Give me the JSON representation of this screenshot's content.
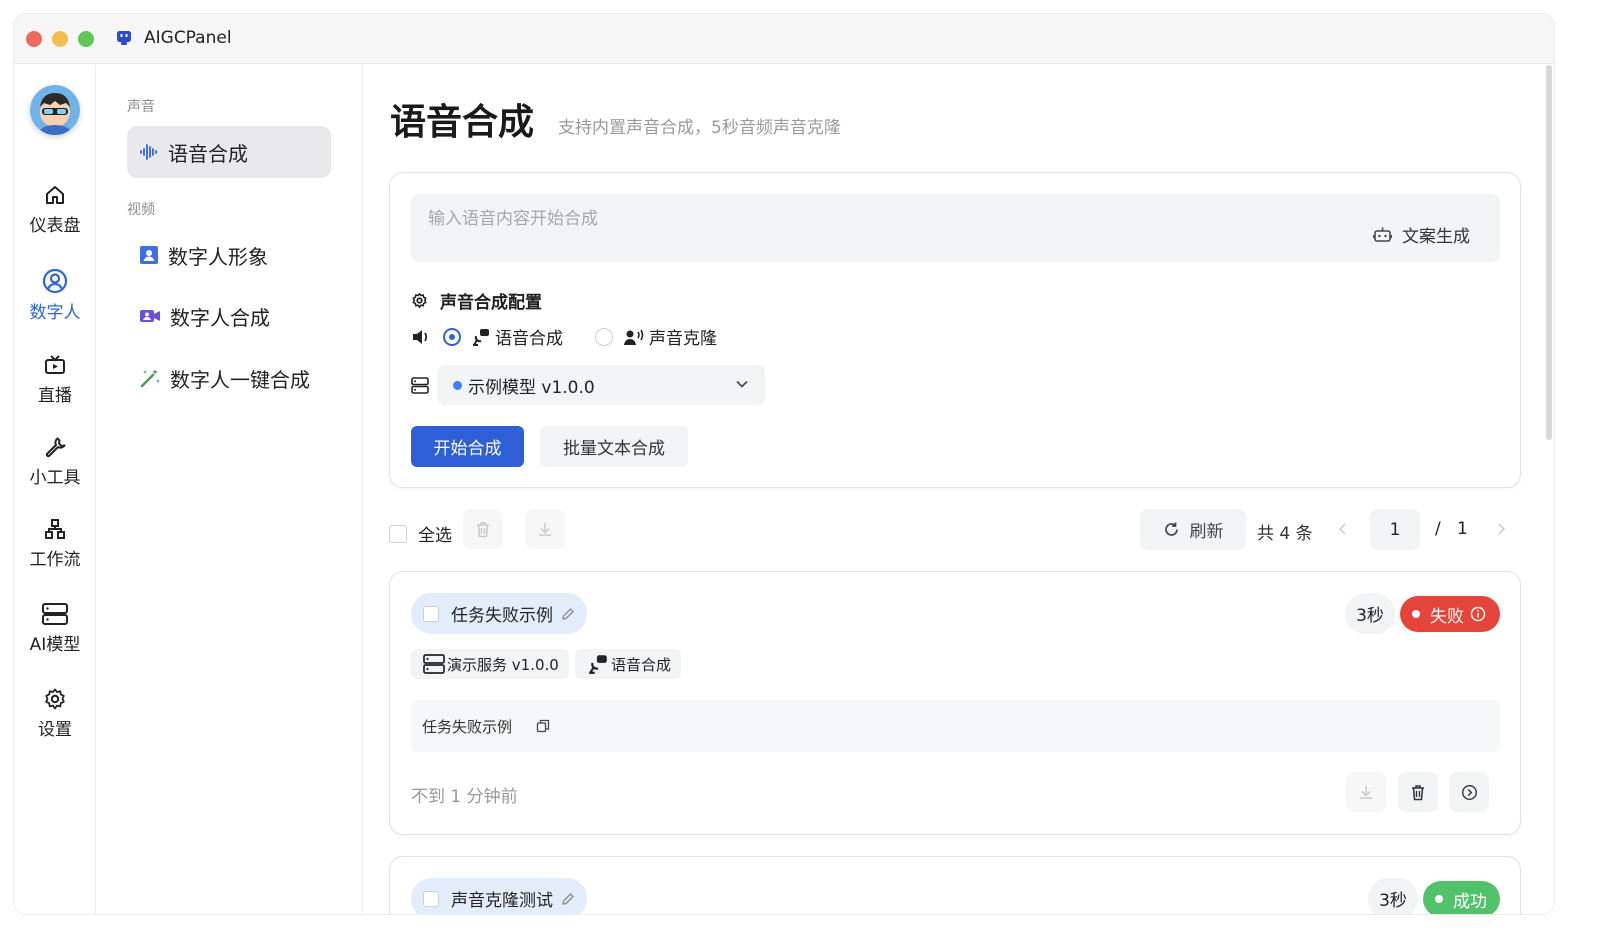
{
  "window": {
    "title": "AIGCPanel"
  },
  "rail": {
    "items": [
      {
        "label": "仪表盘",
        "icon": "home-icon"
      },
      {
        "label": "数字人",
        "icon": "user-circle-icon",
        "active": true
      },
      {
        "label": "直播",
        "icon": "tv-icon"
      },
      {
        "label": "小工具",
        "icon": "wrench-icon"
      },
      {
        "label": "工作流",
        "icon": "workflow-icon"
      },
      {
        "label": "AI模型",
        "icon": "server-icon"
      },
      {
        "label": "设置",
        "icon": "gear-icon"
      }
    ]
  },
  "subnav": {
    "group_sound": "声音",
    "group_video": "视频",
    "items": [
      {
        "label": "语音合成",
        "icon": "waveform-icon",
        "active": true
      },
      {
        "label": "数字人形象",
        "icon": "portrait-icon"
      },
      {
        "label": "数字人合成",
        "icon": "video-camera-icon"
      },
      {
        "label": "数字人一键合成",
        "icon": "magic-wand-icon"
      }
    ]
  },
  "header": {
    "title": "语音合成",
    "subtitle": "支持内置声音合成，5秒音频声音克隆"
  },
  "synth": {
    "placeholder": "输入语音内容开始合成",
    "gen_label": "文案生成",
    "config_title": "声音合成配置",
    "mode_options": [
      {
        "label": "语音合成",
        "selected": true
      },
      {
        "label": "声音克隆",
        "selected": false
      }
    ],
    "model_selected": "示例模型 v1.0.0",
    "start_label": "开始合成",
    "batch_label": "批量文本合成"
  },
  "toolbar": {
    "select_all": "全选",
    "refresh": "刷新",
    "total": "共 4 条",
    "page_current": "1",
    "page_sep": "/",
    "page_total": "1"
  },
  "tasks": [
    {
      "title": "任务失败示例",
      "duration": "3秒",
      "status": "失败",
      "tag_service": "演示服务 v1.0.0",
      "tag_type": "语音合成",
      "content": "任务失败示例",
      "time": "不到 1 分钟前"
    },
    {
      "title": "声音克隆测试",
      "duration": "3秒",
      "status": "成功"
    }
  ],
  "colors": {
    "accent": "#2e5fd8",
    "fail": "#e5443b",
    "success": "#52c26a",
    "title_pill": "#e3ecfa"
  }
}
